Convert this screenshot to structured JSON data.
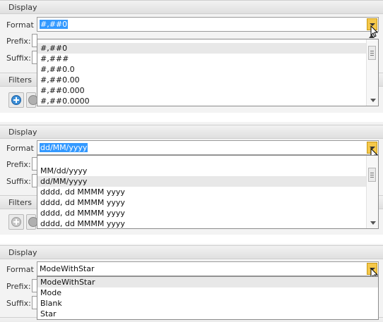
{
  "panels": [
    {
      "section_title": "Display",
      "format_label": "Format",
      "format_value": "#,##0",
      "prefix_label": "Prefix:",
      "suffix_label": "Suffix:",
      "filters_label": "Filters",
      "options": [
        "#,##0",
        "#,###",
        "#,##0.0",
        "#,##0.00",
        "#,##0.000",
        "#,##0.0000"
      ],
      "highlighted_option": "#,##0"
    },
    {
      "section_title": "Display",
      "format_label": "Format",
      "format_value": "dd/MM/yyyy",
      "prefix_label": "Prefix:",
      "suffix_label": "Suffix:",
      "filters_label": "Filters",
      "options": [
        "MM/dd/yyyy",
        "dd/MM/yyyy",
        "dddd, dd MMMM yyyy",
        "dddd, dd MMMM yyyy",
        "dddd, dd MMMM yyyy",
        "dddd, dd MMMM yyyy"
      ],
      "highlighted_option": "dd/MM/yyyy"
    },
    {
      "section_title": "Display",
      "format_label": "Format",
      "format_value": "ModeWithStar",
      "prefix_label": "Prefix:",
      "suffix_label": "Suffix:",
      "options": [
        "ModeWithStar",
        "Mode",
        "Blank",
        "Star"
      ],
      "highlighted_option": "ModeWithStar"
    }
  ],
  "colors": {
    "selection": "#3399ff",
    "dropdown_button": "#f5c84a",
    "add_button": "#3c8fd8",
    "remove_button": "#b0b0b0"
  },
  "icons": {
    "add": "plus-circle-icon",
    "remove": "x-circle-icon",
    "dropdown": "chevron-down-icon",
    "cursor": "mouse-pointer-icon"
  }
}
